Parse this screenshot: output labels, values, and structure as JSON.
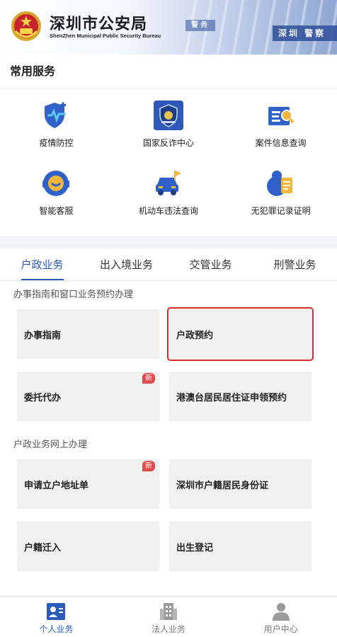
{
  "header": {
    "title": "深圳市公安局",
    "subtitle": "ShenZhen Municipal Public Security Bureau",
    "sign_small": "警务",
    "sign_big": "深圳 警察"
  },
  "common_services": {
    "title": "常用服务",
    "items": [
      {
        "label": "疫情防控",
        "icon": "shield-pulse-icon"
      },
      {
        "label": "国家反诈中心",
        "icon": "anti-fraud-app-icon"
      },
      {
        "label": "案件信息查询",
        "icon": "case-search-icon"
      },
      {
        "label": "智能客服",
        "icon": "smart-service-icon"
      },
      {
        "label": "机动车违法查询",
        "icon": "vehicle-violation-icon"
      },
      {
        "label": "无犯罪记录证明",
        "icon": "no-criminal-record-icon"
      }
    ]
  },
  "tabs": [
    {
      "label": "户政业务",
      "active": true
    },
    {
      "label": "出入境业务",
      "active": false
    },
    {
      "label": "交管业务",
      "active": false
    },
    {
      "label": "刑警业务",
      "active": false
    }
  ],
  "groups": [
    {
      "title": "办事指南和窗口业务预约办理",
      "tiles": [
        {
          "label": "办事指南",
          "badge": ""
        },
        {
          "label": "户政预约",
          "badge": "",
          "selected": true
        },
        {
          "label": "委托代办",
          "badge": "新"
        },
        {
          "label": "港澳台居民居住证申领预约",
          "badge": ""
        }
      ]
    },
    {
      "title": "户政业务网上办理",
      "tiles": [
        {
          "label": "申请立户地址单",
          "badge": "新"
        },
        {
          "label": "深圳市户籍居民身份证",
          "badge": ""
        },
        {
          "label": "户籍迁入",
          "badge": ""
        },
        {
          "label": "出生登记",
          "badge": ""
        }
      ]
    }
  ],
  "bottom_nav": [
    {
      "label": "个人业务",
      "icon": "personal-business-icon",
      "active": true
    },
    {
      "label": "法人业务",
      "icon": "building-icon",
      "active": false
    },
    {
      "label": "用户中心",
      "icon": "user-icon",
      "active": false
    }
  ],
  "colors": {
    "accent": "#2a5bb8",
    "badge": "#e04b4b",
    "selected_outline": "#d8282b"
  }
}
